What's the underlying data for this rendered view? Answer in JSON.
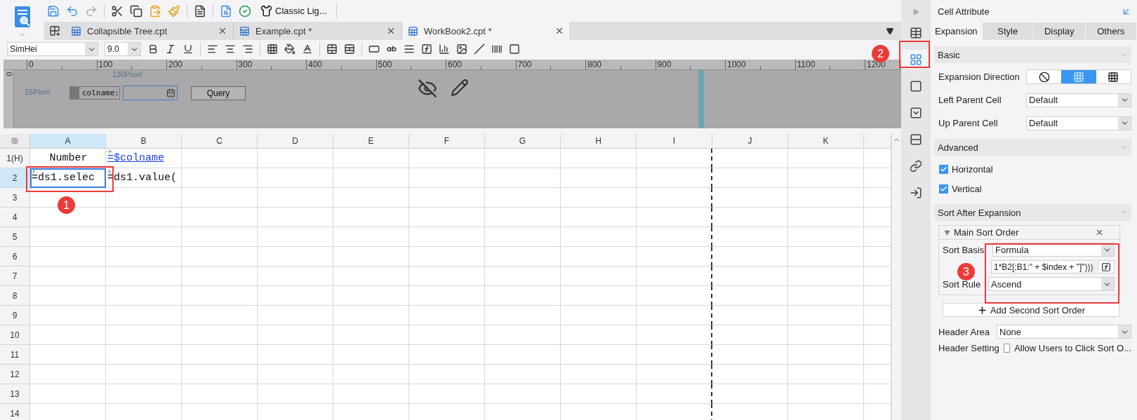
{
  "toolbar": {
    "theme_button": "Classic Lig..."
  },
  "tabs": [
    {
      "label": "Collapsible Tree.cpt",
      "selected": false
    },
    {
      "label": "Example.cpt *",
      "selected": false
    },
    {
      "label": "WorkBook2.cpt *",
      "selected": true
    }
  ],
  "format_bar": {
    "font": "SimHei",
    "size": "9.0"
  },
  "parameter_pane": {
    "ruler_ticks": [
      "0",
      "100",
      "200",
      "300",
      "400",
      "500",
      "600",
      "700",
      "800",
      "900",
      "1000",
      "1100",
      "1200"
    ],
    "vertical_tick": "0",
    "width_label": "130Pixel",
    "height_label": "25Pixel",
    "param_label": "colname:",
    "query_button": "Query"
  },
  "sheet": {
    "columns": [
      {
        "label": "A",
        "selected": true,
        "page_break": false
      },
      {
        "label": "B",
        "selected": false,
        "page_break": false
      },
      {
        "label": "C",
        "selected": false,
        "page_break": false
      },
      {
        "label": "D",
        "selected": false,
        "page_break": false
      },
      {
        "label": "E",
        "selected": false,
        "page_break": false
      },
      {
        "label": "F",
        "selected": false,
        "page_break": false
      },
      {
        "label": "G",
        "selected": false,
        "page_break": false
      },
      {
        "label": "H",
        "selected": false,
        "page_break": false
      },
      {
        "label": "I",
        "selected": false,
        "page_break": true
      },
      {
        "label": "J",
        "selected": false,
        "page_break": false
      },
      {
        "label": "K",
        "selected": false,
        "page_break": false
      }
    ],
    "rows": [
      {
        "header": "1(H)",
        "selected": false,
        "cells": [
          {
            "text": "Number",
            "kind": "plain",
            "selected": false
          },
          {
            "text": "=$colname",
            "kind": "link",
            "expand_right": true,
            "selected": false
          }
        ]
      },
      {
        "header": "2",
        "selected": true,
        "cells": [
          {
            "text": "=ds1.selec",
            "kind": "plain",
            "expand_down": true,
            "selected": true
          },
          {
            "text": "=ds1.value(",
            "kind": "plain",
            "expand_down": true,
            "selected": false
          }
        ]
      },
      {
        "header": "3",
        "selected": false,
        "cells": []
      },
      {
        "header": "4",
        "selected": false,
        "cells": []
      },
      {
        "header": "5",
        "selected": false,
        "cells": []
      },
      {
        "header": "6",
        "selected": false,
        "cells": []
      },
      {
        "header": "7",
        "selected": false,
        "cells": []
      },
      {
        "header": "8",
        "selected": false,
        "cells": []
      },
      {
        "header": "9",
        "selected": false,
        "cells": []
      },
      {
        "header": "10",
        "selected": false,
        "cells": []
      },
      {
        "header": "11",
        "selected": false,
        "cells": []
      },
      {
        "header": "12",
        "selected": false,
        "cells": []
      },
      {
        "header": "13",
        "selected": false,
        "cells": []
      },
      {
        "header": "14",
        "selected": false,
        "cells": []
      }
    ]
  },
  "side_icons": [
    {
      "selected": false
    },
    {
      "selected": true
    },
    {
      "selected": false
    },
    {
      "selected": false
    },
    {
      "selected": false
    },
    {
      "selected": false
    },
    {
      "selected": false
    }
  ],
  "panel": {
    "title": "Cell Attribute",
    "tabs": [
      {
        "label": "Expansion",
        "selected": true
      },
      {
        "label": "Style",
        "selected": false
      },
      {
        "label": "Display",
        "selected": false
      },
      {
        "label": "Others",
        "selected": false
      }
    ],
    "basic": {
      "heading": "Basic",
      "direction_label": "Expansion Direction",
      "directions": [
        {
          "selected": false
        },
        {
          "selected": true
        },
        {
          "selected": false
        }
      ],
      "fields": [
        {
          "label": "Left Parent Cell",
          "value": "Default"
        },
        {
          "label": "Up Parent Cell",
          "value": "Default"
        }
      ]
    },
    "advanced": {
      "heading": "Advanced",
      "options": [
        {
          "label": "Horizontal",
          "checked": true
        },
        {
          "label": "Vertical",
          "checked": true
        }
      ]
    },
    "sort": {
      "heading": "Sort After Expansion",
      "group": {
        "title": "Main Sort Order",
        "basis_label": "Sort Basis",
        "basis": "Formula",
        "formula": "1*B2[;B1:\" + $index + \"]\")))",
        "rule_label": "Sort Rule",
        "rule": "Ascend"
      },
      "add_button": "Add Second Sort Order",
      "header_area_label": "Header Area",
      "header_area": "None",
      "header_setting_label": "Header Setting",
      "allow_sort": {
        "label": "Allow Users to Click Sort O...",
        "checked": false
      }
    }
  },
  "callouts": [
    {
      "label": "1"
    },
    {
      "label": "2"
    },
    {
      "label": "3"
    }
  ]
}
